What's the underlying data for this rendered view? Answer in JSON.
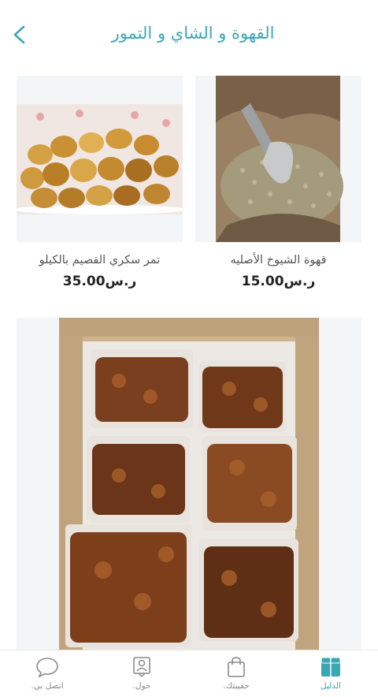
{
  "header": {
    "title": "القهوة و الشاي و التمور",
    "back_icon": "chevron-left-icon"
  },
  "products": [
    {
      "name": "قهوة الشيوخ الأصليه",
      "price": "ر.س15.00",
      "image": "green-coffee-beans-with-scoop"
    },
    {
      "name": "تمر سكري القصيم بالكيلو",
      "price": "ر.س35.00",
      "image": "sukkari-dates-plate"
    }
  ],
  "featured_image": "dates-vacuum-packs-in-box",
  "tabbar": {
    "items": [
      {
        "label": "اتصل بي.",
        "icon": "chat-bubble-icon",
        "active": false
      },
      {
        "label": "حول.",
        "icon": "profile-card-icon",
        "active": false
      },
      {
        "label": "حقيبتك.",
        "icon": "shopping-bag-icon",
        "active": false
      },
      {
        "label": "الدليل",
        "icon": "catalog-icon",
        "active": true
      }
    ]
  },
  "colors": {
    "accent": "#3aa7b5",
    "card_bg": "#f4f5f7"
  }
}
